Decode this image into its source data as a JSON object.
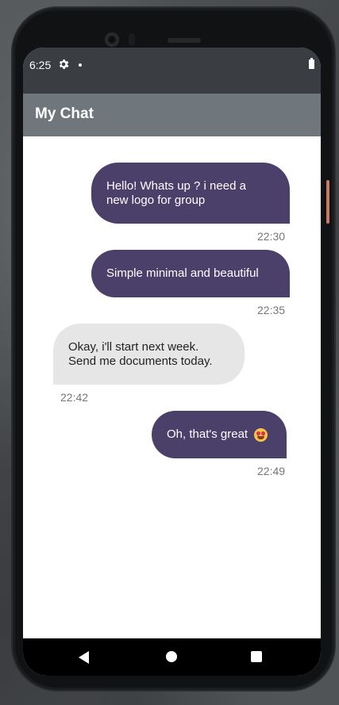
{
  "status_bar": {
    "time": "6:25",
    "icons": [
      "gear-icon",
      "notification-dot-icon",
      "battery-icon"
    ]
  },
  "app_bar": {
    "title": "My Chat",
    "color": "#70777c"
  },
  "colors": {
    "outgoing_bubble": "#4a4069",
    "incoming_bubble": "#e6e6e6",
    "timestamp": "#777777"
  },
  "messages": [
    {
      "direction": "outgoing",
      "lines": [
        "Hello! Whats up ? i need a",
        "new logo for group"
      ],
      "time": "22:30"
    },
    {
      "direction": "outgoing",
      "text": "Simple minimal and beautiful",
      "time": "22:35"
    },
    {
      "direction": "incoming",
      "lines": [
        "Okay, i'll start next week.",
        "Send me documents today."
      ],
      "time": "22:42"
    },
    {
      "direction": "outgoing",
      "text": "Oh, that's great",
      "emoji": "heart-eyes-emoji-icon",
      "time": "22:49"
    }
  ],
  "nav_bar": {
    "buttons": [
      "back-icon",
      "home-icon",
      "recents-icon"
    ]
  }
}
